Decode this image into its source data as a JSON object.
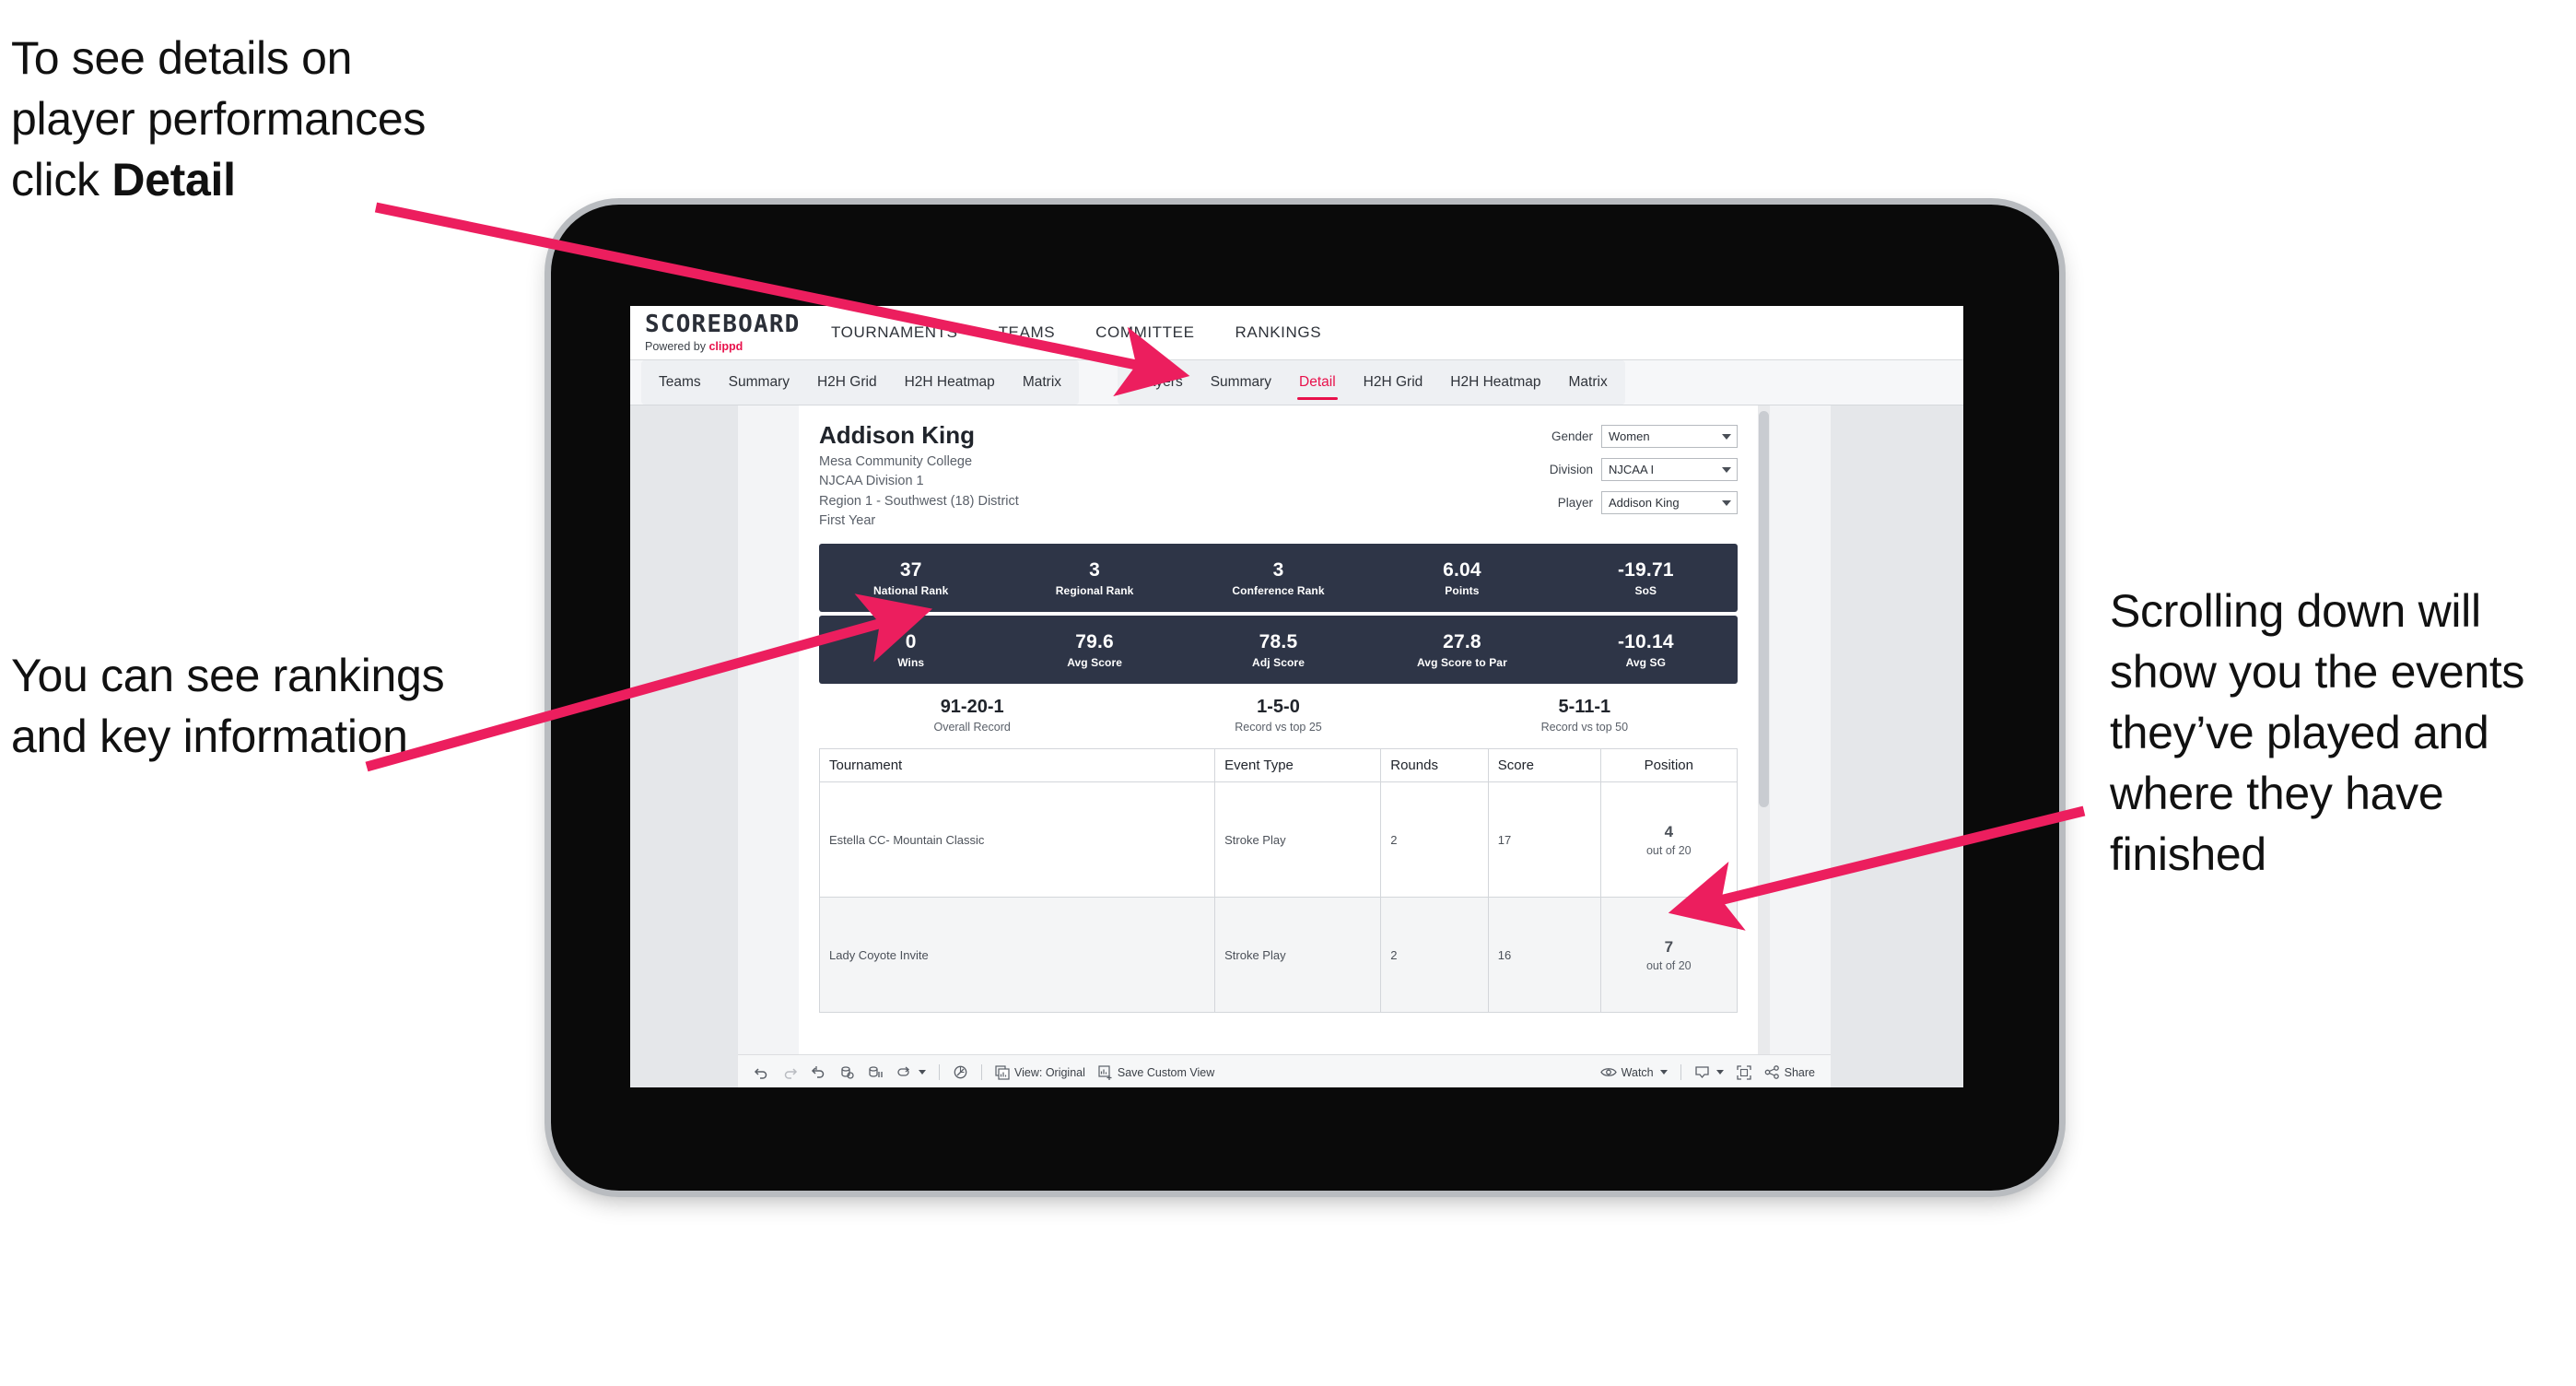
{
  "annotations": {
    "top_left": {
      "lines": [
        "To see details on",
        "player performances",
        "click "
      ],
      "bold_word": "Detail"
    },
    "middle_left": "You can see rankings and key information",
    "right": "Scrolling down will show you the events they’ve played and where they have finished",
    "arrow_color": "#ec1e5e"
  },
  "app": {
    "brand": {
      "title": "SCOREBOARD",
      "powered_prefix": "Powered by ",
      "powered_brand": "clippd"
    },
    "top_nav": [
      "TOURNAMENTS",
      "TEAMS",
      "COMMITTEE",
      "RANKINGS"
    ],
    "tabs_group_teams": [
      "Teams",
      "Summary",
      "H2H Grid",
      "H2H Heatmap",
      "Matrix"
    ],
    "tabs_group_players": [
      "Players",
      "Summary",
      "Detail",
      "H2H Grid",
      "H2H Heatmap",
      "Matrix"
    ],
    "active_tab": "Detail",
    "accent_color": "#e8114b",
    "band_color": "#2e3547"
  },
  "player": {
    "name": "Addison King",
    "school": "Mesa Community College",
    "division": "NJCAA Division 1",
    "region": "Region 1 - Southwest (18) District",
    "year": "First Year"
  },
  "filters": [
    {
      "label": "Gender",
      "value": "Women"
    },
    {
      "label": "Division",
      "value": "NJCAA I"
    },
    {
      "label": "Player",
      "value": "Addison King"
    }
  ],
  "stats_row_1": [
    {
      "value": "37",
      "label": "National Rank"
    },
    {
      "value": "3",
      "label": "Regional Rank"
    },
    {
      "value": "3",
      "label": "Conference Rank"
    },
    {
      "value": "6.04",
      "label": "Points"
    },
    {
      "value": "-19.71",
      "label": "SoS"
    }
  ],
  "stats_row_2": [
    {
      "value": "0",
      "label": "Wins"
    },
    {
      "value": "79.6",
      "label": "Avg Score"
    },
    {
      "value": "78.5",
      "label": "Adj Score"
    },
    {
      "value": "27.8",
      "label": "Avg Score to Par"
    },
    {
      "value": "-10.14",
      "label": "Avg SG"
    }
  ],
  "records": [
    {
      "value": "91-20-1",
      "label": "Overall Record"
    },
    {
      "value": "1-5-0",
      "label": "Record vs top 25"
    },
    {
      "value": "5-11-1",
      "label": "Record vs top 50"
    }
  ],
  "events_table": {
    "columns": [
      "Tournament",
      "Event Type",
      "Rounds",
      "Score",
      "Position"
    ],
    "rows": [
      {
        "tournament": "Estella CC- Mountain Classic",
        "event_type": "Stroke Play",
        "rounds": "2",
        "score": "17",
        "position": "4",
        "position_sub": "out of 20"
      },
      {
        "tournament": "Lady Coyote Invite",
        "event_type": "Stroke Play",
        "rounds": "2",
        "score": "16",
        "position": "7",
        "position_sub": "out of 20"
      }
    ]
  },
  "toolbar": {
    "view_label": "View: Original",
    "save_label": "Save Custom View",
    "watch_label": "Watch",
    "share_label": "Share"
  }
}
